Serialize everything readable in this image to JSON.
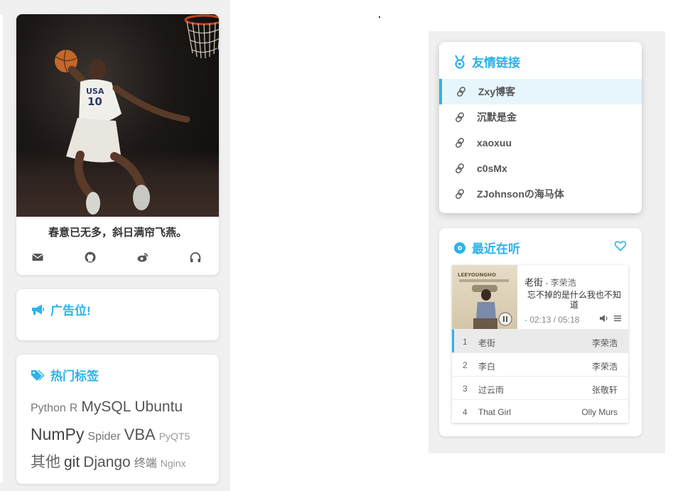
{
  "profile": {
    "motto": "春意已无多，斜日满帘飞燕。",
    "jersey_text": "USA",
    "jersey_number": "10",
    "social_icons": [
      "envelope-icon",
      "github-icon",
      "weibo-icon",
      "headphones-icon"
    ]
  },
  "ad": {
    "title": "广告位!",
    "icon": "bullhorn-icon"
  },
  "tags": {
    "title": "热门标签",
    "icon": "tags-icon",
    "items": [
      "Python",
      "R",
      "MySQL",
      "Ubuntu",
      "NumPy",
      "Spider",
      "VBA",
      "PyQT5",
      "其他",
      "git",
      "Django",
      "终端",
      "Nginx"
    ]
  },
  "friend_links": {
    "title": "友情链接",
    "icon": "medal-icon",
    "items": [
      "Zxy博客",
      "沉默是金",
      "xaoxuu",
      "c0sMx",
      "ZJohnsonの海马体"
    ]
  },
  "music": {
    "title": "最近在听",
    "icon": "disc-icon",
    "fav_icon": "heart-icon",
    "cover_text": "LEEYOUNGHO",
    "now_playing": {
      "title": "老街",
      "artist": "李荣浩",
      "separator": " - ",
      "lyric": "忘不掉的是什么我也不知道",
      "time_prefix": "- ",
      "current": "02:13",
      "duration": "05:18"
    },
    "playlist": [
      {
        "num": "1",
        "name": "老街",
        "artist": "李荣浩"
      },
      {
        "num": "2",
        "name": "李白",
        "artist": "李荣浩"
      },
      {
        "num": "3",
        "name": "过云雨",
        "artist": "张敬轩"
      },
      {
        "num": "4",
        "name": "That Girl",
        "artist": "Olly Murs"
      }
    ]
  },
  "colors": {
    "accent": "#2bb3e8",
    "panel_bg": "#f0f0f0"
  }
}
